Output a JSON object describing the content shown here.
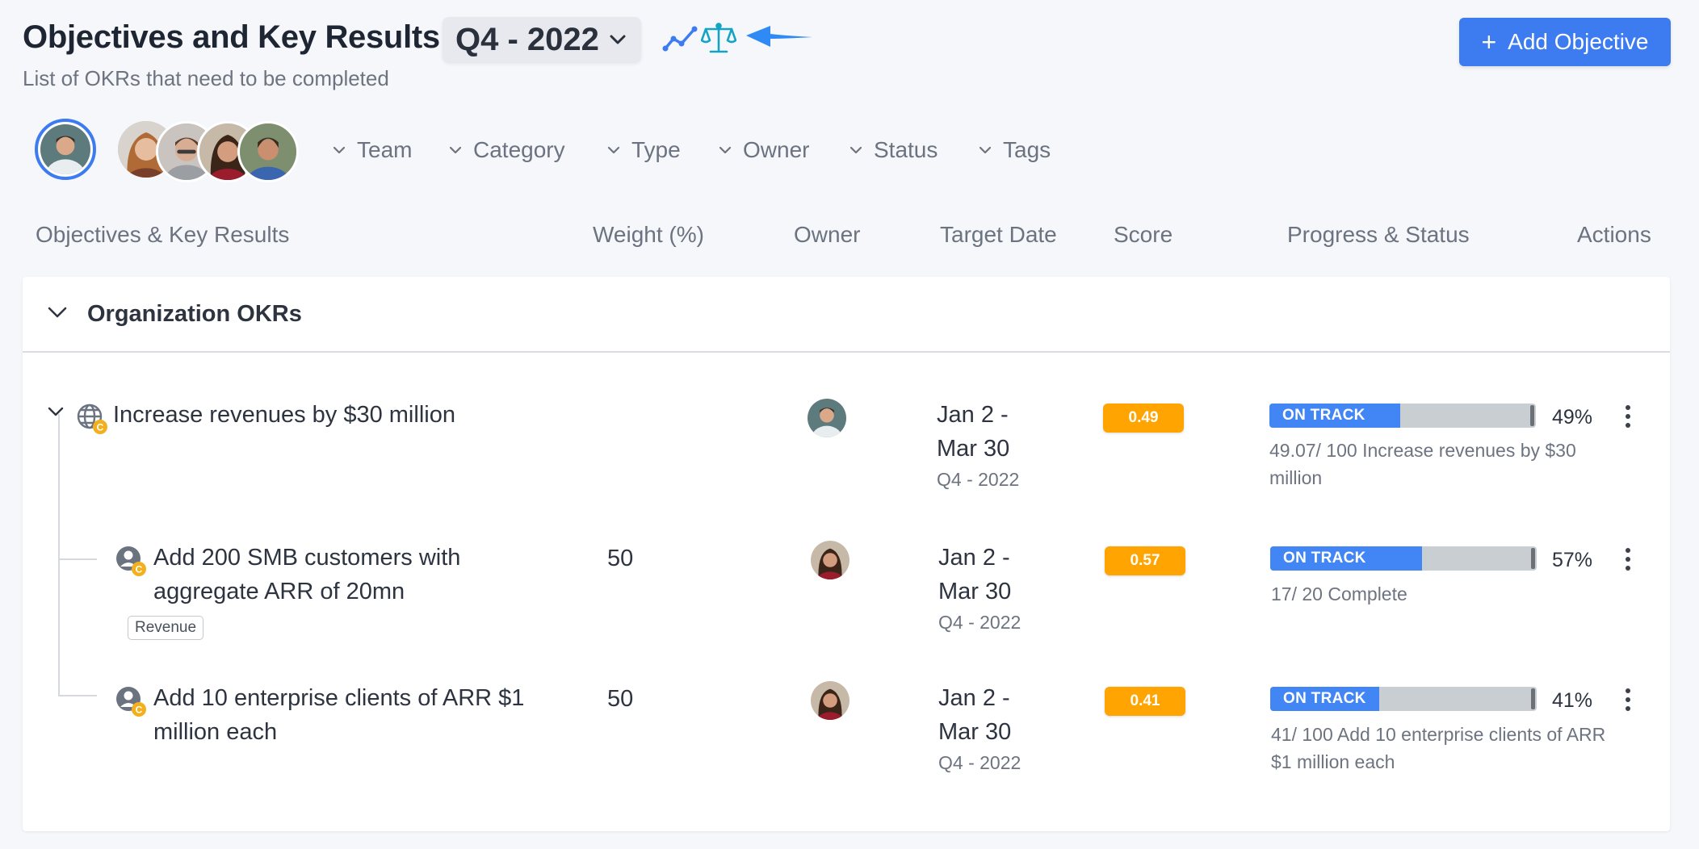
{
  "header": {
    "title": "Objectives and Key Results -",
    "period": "Q4 - 2022",
    "subtitle": "List of OKRs that need to be completed",
    "add_button_label": "Add Objective",
    "add_button_plus": "+"
  },
  "filters": [
    "Team",
    "Category",
    "Type",
    "Owner",
    "Status",
    "Tags"
  ],
  "columns": {
    "objectives": "Objectives & Key Results",
    "weight": "Weight (%)",
    "owner": "Owner",
    "target_date": "Target Date",
    "score": "Score",
    "progress": "Progress & Status",
    "actions": "Actions"
  },
  "group": {
    "title": "Organization OKRs"
  },
  "rows": [
    {
      "title": "Increase revenues by $30 million",
      "weight": "",
      "date_line1": "Jan 2 -",
      "date_line2": "Mar 30",
      "date_period": "Q4 - 2022",
      "score": "0.49",
      "status": "ON TRACK",
      "progress": 0.49,
      "percent": "49%",
      "progress_text": "49.07/ 100  Increase revenues by $30 million",
      "badge": "C"
    },
    {
      "title": "Add 200 SMB customers with aggregate ARR of 20mn",
      "weight": "50",
      "tag": "Revenue",
      "date_line1": "Jan 2 -",
      "date_line2": "Mar 30",
      "date_period": "Q4 - 2022",
      "score": "0.57",
      "status": "ON TRACK",
      "progress": 0.57,
      "percent": "57%",
      "progress_text": "17/ 20  Complete",
      "badge": "C"
    },
    {
      "title": "Add 10 enterprise clients of ARR $1 million each",
      "weight": "50",
      "date_line1": "Jan 2 -",
      "date_line2": "Mar 30",
      "date_period": "Q4 - 2022",
      "score": "0.41",
      "status": "ON TRACK",
      "progress": 0.41,
      "percent": "41%",
      "progress_text": "41/ 100  Add 10 enterprise clients of ARR $1 million each",
      "badge": "C"
    }
  ],
  "icons": {
    "period_chevron": "chevron-down-icon",
    "trend": "trend-line-icon",
    "balance": "balance-scale-icon",
    "arrow": "arrow-left-icon",
    "objective_type": "globe-icon",
    "key_result_type": "person-icon"
  },
  "colors": {
    "accent": "#3d7bf0",
    "score": "#ffa400",
    "progress_fill": "#4285f4",
    "progress_track": "#c9ced3",
    "badge": "#f2b01e",
    "balance_icon": "#13a4c4"
  }
}
